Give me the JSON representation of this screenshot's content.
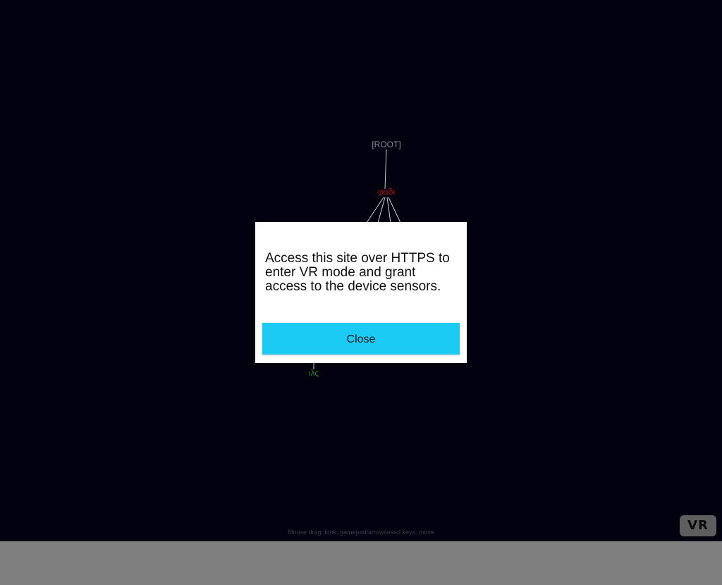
{
  "scene": {
    "root_label": "[ROOT]",
    "node_label_red": "φαδι",
    "node_label_green": "ιλς",
    "hint_text": "Mouse drag: look, gamepad/arrow/wasd keys: move",
    "colors": {
      "background": "#02010f",
      "root_label": "#8a8aa0",
      "red_label": "#b01010",
      "green_label": "#1f8a1f",
      "edges": "#c8c8d0"
    }
  },
  "vr_button": {
    "label": "VR"
  },
  "modal": {
    "message": "Access this site over HTTPS to enter VR mode and grant access to the device sensors.",
    "close_label": "Close",
    "accent_color": "#1ccbf4"
  }
}
